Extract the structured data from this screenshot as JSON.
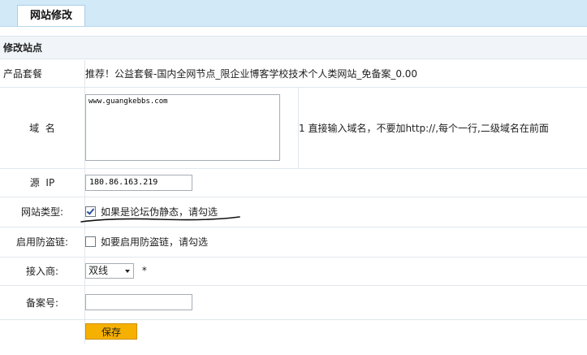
{
  "header": {
    "tab_label": "网站修改"
  },
  "section": {
    "title": "修改站点"
  },
  "rows": {
    "package": {
      "label": "产品套餐",
      "value": "推荐！公益套餐-国内全网节点_限企业博客学校技术个人类网站_免备案_0.00"
    },
    "domain": {
      "label": "域  名",
      "value": "www.guangkebbs.com",
      "hint": "1 直接输入域名，不要加http://,每个一行,二级域名在前面"
    },
    "source_ip": {
      "label": "源  IP",
      "value": "180.86.163.219"
    },
    "site_type": {
      "label": "网站类型:",
      "checkbox_label": "如果是论坛伪静态，请勾选",
      "checked": true
    },
    "hotlink": {
      "label": "启用防盗链:",
      "checkbox_label": "如要启用防盗链，请勾选",
      "checked": false
    },
    "provider": {
      "label": "接入商:",
      "selected": "双线",
      "required_mark": "*"
    },
    "record": {
      "label": "备案号:",
      "value": ""
    }
  },
  "actions": {
    "save_label": "保存"
  },
  "colors": {
    "topbar": "#d2e9f7",
    "save_button": "#f6b000",
    "header_band": "#f1f5f9"
  }
}
